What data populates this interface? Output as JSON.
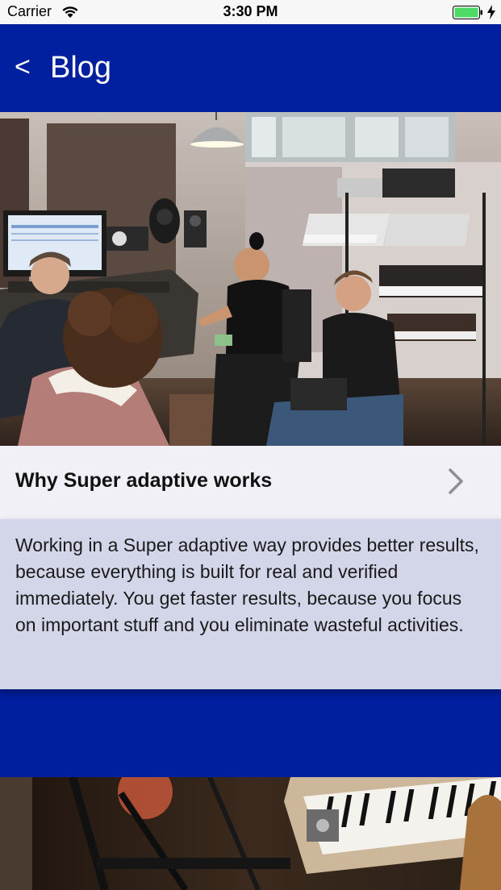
{
  "status_bar": {
    "carrier": "Carrier",
    "time": "3:30 PM",
    "icons": [
      "wifi-icon",
      "battery-icon",
      "charging-icon"
    ],
    "battery_color": "#4cd964"
  },
  "nav": {
    "back_label": "<",
    "title": "Blog",
    "background_color": "#00209f"
  },
  "posts": [
    {
      "image": "studio-photo",
      "title": "Why Super adaptive works",
      "excerpt": "Working in a Super adaptive way provides better results, because everything is built for real and verified immediately. You get faster results, because you focus on important stuff and you eliminate wasteful activities."
    },
    {
      "image": "keyboard-photo"
    }
  ],
  "colors": {
    "page_background": "#001f9e",
    "row_background": "#f0f0f6",
    "excerpt_background": "#d2d6e8"
  }
}
